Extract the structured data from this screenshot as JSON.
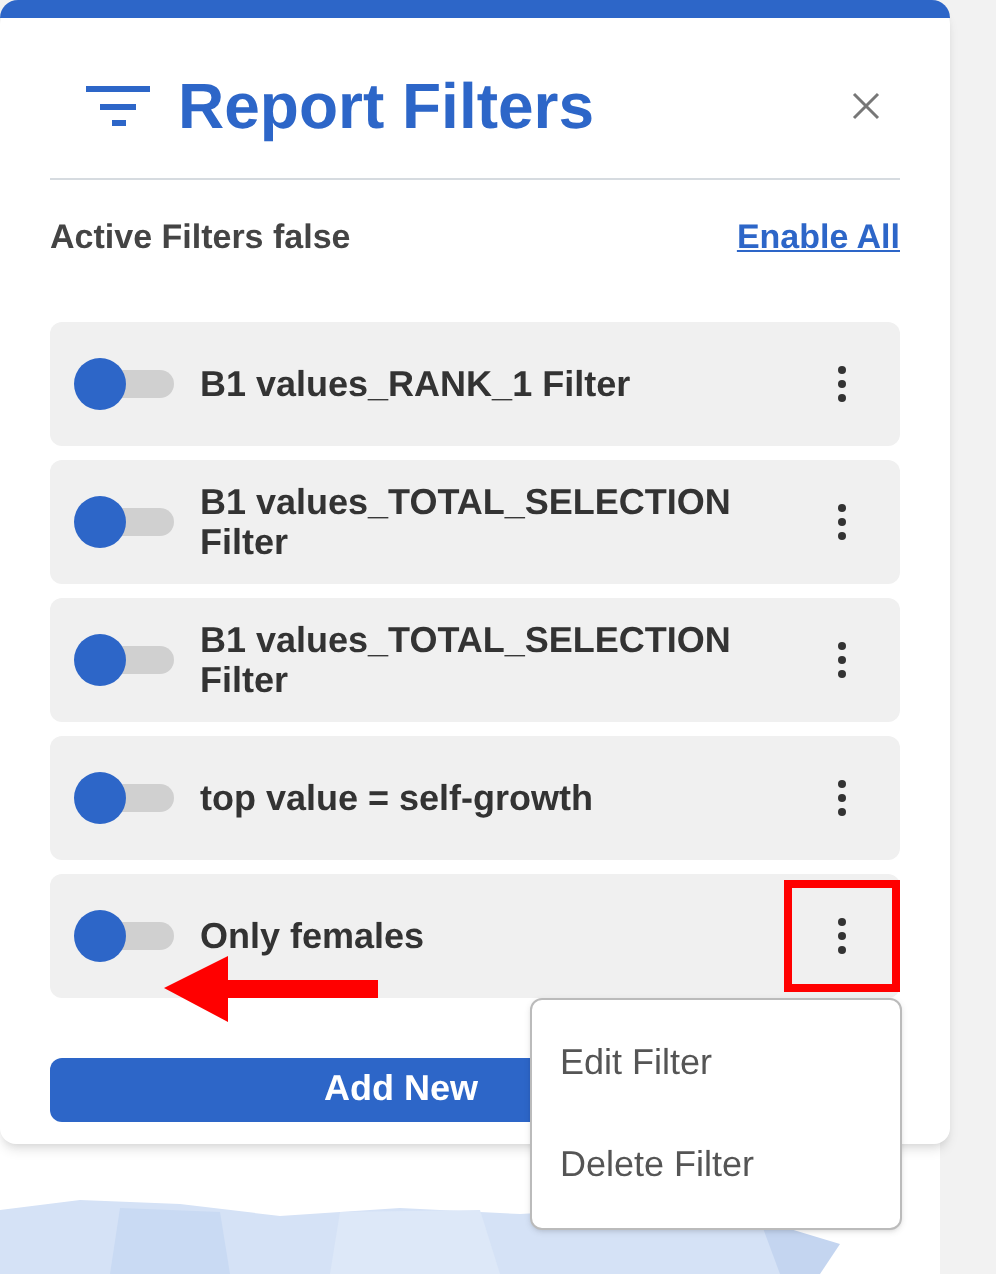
{
  "panel": {
    "title": "Report Filters",
    "status_label": "Active Filters false",
    "enable_all_link": "Enable All"
  },
  "filters": [
    {
      "label": "B1 values_RANK_1 Filter",
      "on": false,
      "menu_open": false
    },
    {
      "label": "B1 values_TOTAL_SELECTION Filter",
      "on": false,
      "menu_open": false
    },
    {
      "label": "B1 values_TOTAL_SELECTION Filter",
      "on": false,
      "menu_open": false
    },
    {
      "label": "top value = self-growth",
      "on": false,
      "menu_open": false
    },
    {
      "label": "Only females",
      "on": false,
      "menu_open": true
    }
  ],
  "add_button": "Add New",
  "filter_menu": [
    "Edit Filter",
    "Delete Filter"
  ]
}
